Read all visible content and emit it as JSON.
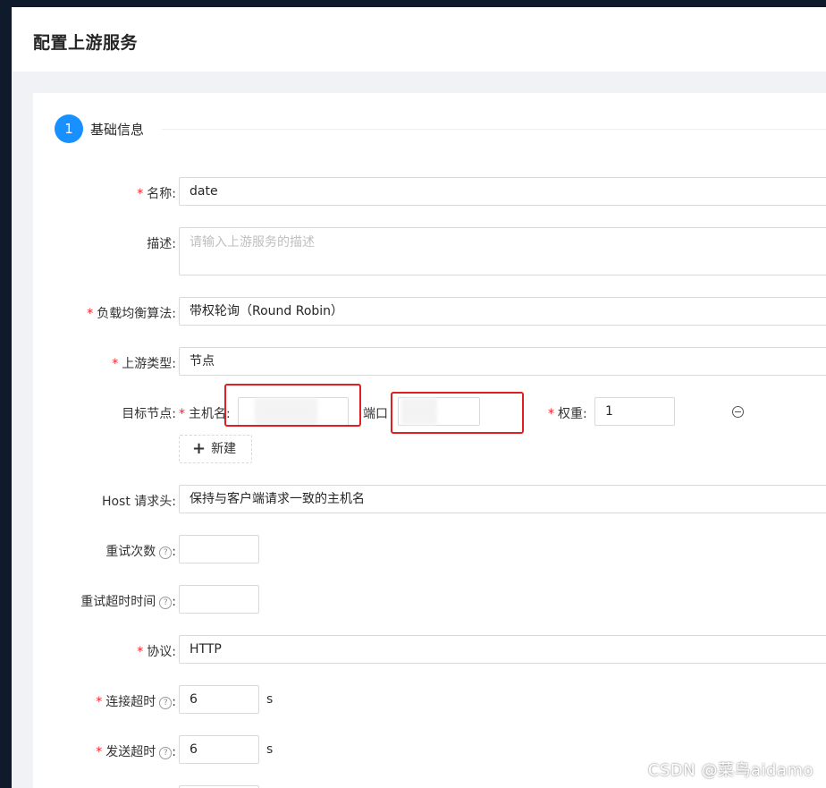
{
  "page": {
    "title": "配置上游服务"
  },
  "step": {
    "number": "1",
    "title": "基础信息"
  },
  "form": {
    "name": {
      "label": "名称:",
      "value": "date"
    },
    "description": {
      "label": "描述:",
      "placeholder": "请输入上游服务的描述"
    },
    "load_balance": {
      "label": "负载均衡算法:",
      "value": "带权轮询（Round Robin）"
    },
    "upstream_type": {
      "label": "上游类型:",
      "value": "节点"
    },
    "target_node": {
      "label": "目标节点:",
      "hostname_label": "主机名:",
      "port_label": "端口",
      "weight_label": "权重:",
      "weight_value": "1",
      "add_label": "新建"
    },
    "host_header": {
      "label": "Host 请求头:",
      "value": "保持与客户端请求一致的主机名"
    },
    "retries": {
      "label": "重试次数",
      "value": ""
    },
    "retry_timeout": {
      "label": "重试超时时间",
      "value": ""
    },
    "protocol": {
      "label": "协议:",
      "value": "HTTP"
    },
    "connect_timeout": {
      "label": "连接超时",
      "value": "6",
      "unit": "s"
    },
    "send_timeout": {
      "label": "发送超时",
      "value": "6",
      "unit": "s"
    }
  },
  "watermark": "CSDN @菜鸟aidamo",
  "colors": {
    "primary": "#1890ff",
    "required": "#f5222d",
    "highlight": "#e02020"
  }
}
